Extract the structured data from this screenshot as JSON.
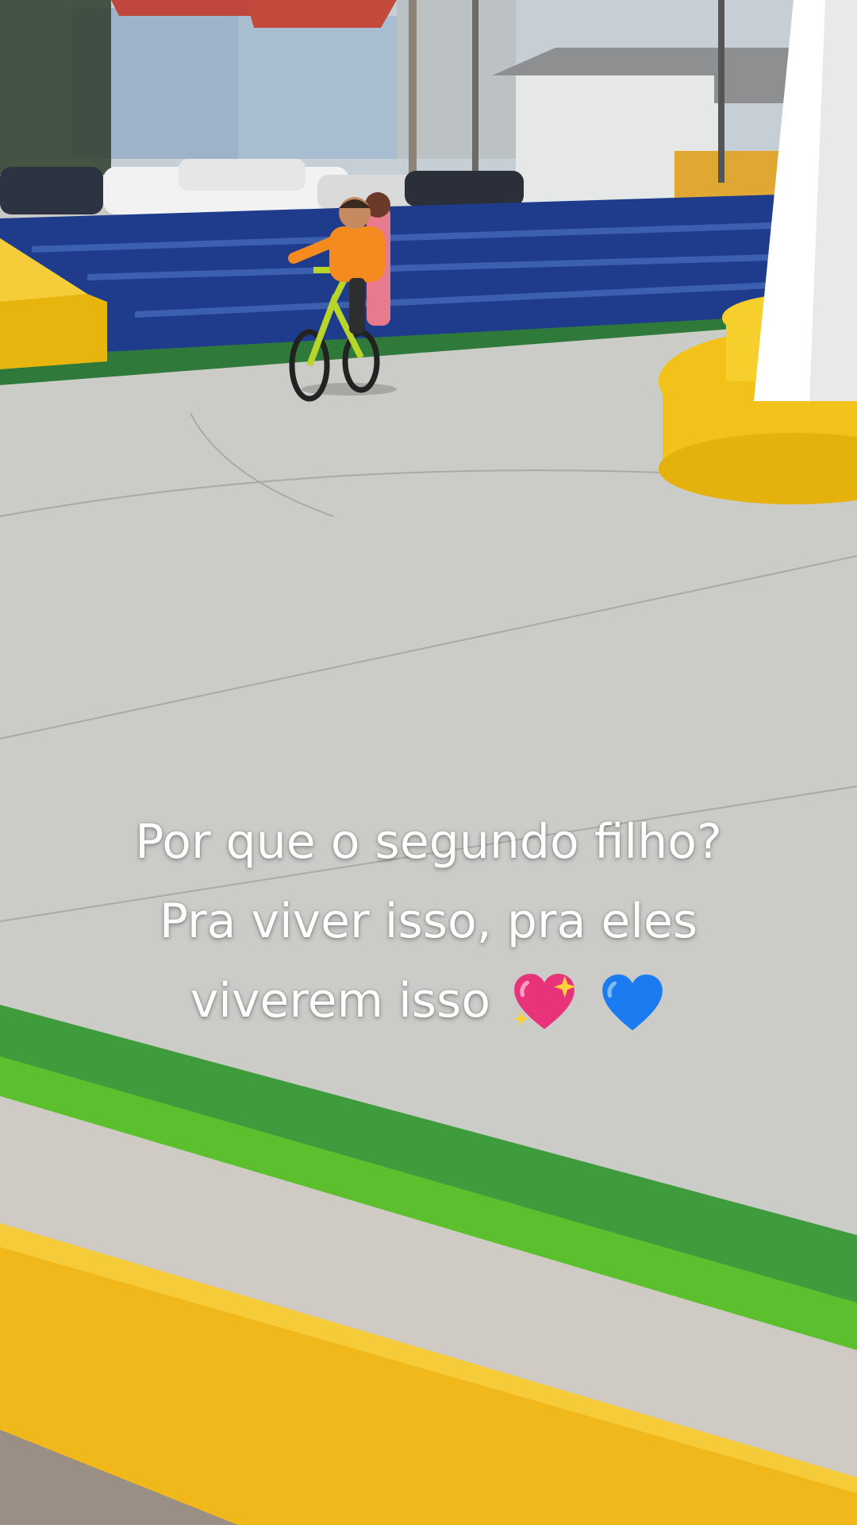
{
  "caption": {
    "line1": "Por que o segundo filho?",
    "line2": "Pra viver isso, pra eles",
    "line3": "viverem isso"
  },
  "emojis": [
    "sparkling-heart-icon",
    "blue-heart-icon"
  ],
  "colors": {
    "sky": "#b7d6f2",
    "pavement": "#c9c9c6",
    "blue_wall": "#1f3c8c",
    "yellow_paint": "#f2c21a",
    "green_paint": "#3d9a3c",
    "shirt_orange": "#f58a1f",
    "bike_green": "#b8d62a"
  }
}
